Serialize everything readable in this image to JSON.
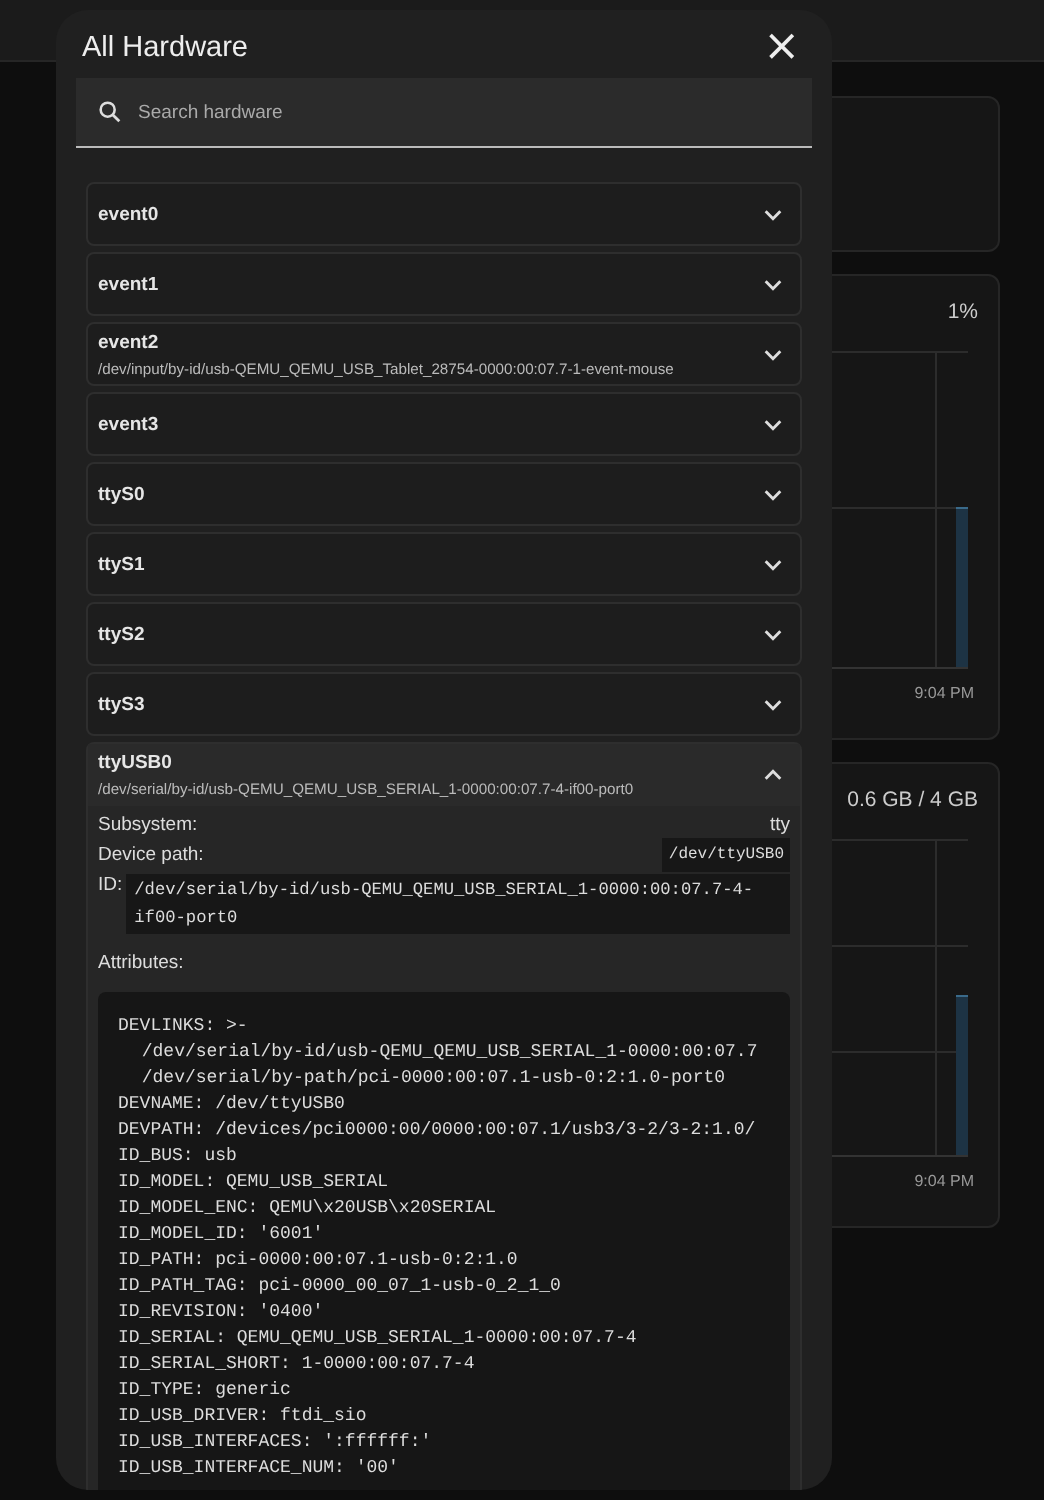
{
  "background": {
    "cards": [
      {
        "kind": "empty"
      },
      {
        "kind": "chart",
        "value": "1%",
        "time_label": "9:04 PM"
      },
      {
        "kind": "chart",
        "value": "0.6 GB / 4 GB",
        "time_label": "9:04 PM"
      }
    ]
  },
  "dialog": {
    "title": "All Hardware",
    "close": "×",
    "search": {
      "placeholder": "Search hardware"
    },
    "items": [
      {
        "name": "event0",
        "expanded": false
      },
      {
        "name": "event1",
        "expanded": false
      },
      {
        "name": "event2",
        "path": "/dev/input/by-id/usb-QEMU_QEMU_USB_Tablet_28754-0000:00:07.7-1-event-mouse",
        "expanded": false
      },
      {
        "name": "event3",
        "expanded": false
      },
      {
        "name": "ttyS0",
        "expanded": false
      },
      {
        "name": "ttyS1",
        "expanded": false
      },
      {
        "name": "ttyS2",
        "expanded": false
      },
      {
        "name": "ttyS3",
        "expanded": false
      },
      {
        "name": "ttyUSB0",
        "path": "/dev/serial/by-id/usb-QEMU_QEMU_USB_SERIAL_1-0000:00:07.7-4-if00-port0",
        "expanded": true,
        "details": {
          "subsystem_label": "Subsystem:",
          "subsystem": "tty",
          "device_path_label": "Device path:",
          "device_path": "/dev/ttyUSB0",
          "id_label": "ID:",
          "id": "/dev/serial/by-id/usb-QEMU_QEMU_USB_SERIAL_1-0000:00:07.7-4-if00-port0",
          "attributes_label": "Attributes:",
          "attributes": [
            {
              "kind": "key",
              "text": "DEVLINKS: >-"
            },
            {
              "kind": "continuation",
              "text": "/dev/serial/by-id/usb-QEMU_QEMU_USB_SERIAL_1-0000:00:07.7"
            },
            {
              "kind": "continuation",
              "text": "/dev/serial/by-path/pci-0000:00:07.1-usb-0:2:1.0-port0"
            },
            {
              "kind": "key",
              "text": "DEVNAME: /dev/ttyUSB0"
            },
            {
              "kind": "key",
              "text": "DEVPATH: /devices/pci0000:00/0000:00:07.1/usb3/3-2/3-2:1.0/"
            },
            {
              "kind": "key",
              "text": "ID_BUS: usb"
            },
            {
              "kind": "key",
              "text": "ID_MODEL: QEMU_USB_SERIAL"
            },
            {
              "kind": "key",
              "text": "ID_MODEL_ENC: QEMU\\x20USB\\x20SERIAL"
            },
            {
              "kind": "key",
              "text": "ID_MODEL_ID: '6001'"
            },
            {
              "kind": "key",
              "text": "ID_PATH: pci-0000:00:07.1-usb-0:2:1.0"
            },
            {
              "kind": "key",
              "text": "ID_PATH_TAG: pci-0000_00_07_1-usb-0_2_1_0"
            },
            {
              "kind": "key",
              "text": "ID_REVISION: '0400'"
            },
            {
              "kind": "key",
              "text": "ID_SERIAL: QEMU_QEMU_USB_SERIAL_1-0000:00:07.7-4"
            },
            {
              "kind": "key",
              "text": "ID_SERIAL_SHORT: 1-0000:00:07.7-4"
            },
            {
              "kind": "key",
              "text": "ID_TYPE: generic"
            },
            {
              "kind": "key",
              "text": "ID_USB_DRIVER: ftdi_sio"
            },
            {
              "kind": "key",
              "text": "ID_USB_INTERFACES: ':ffffff:'"
            },
            {
              "kind": "key",
              "text": "ID_USB_INTERFACE_NUM: '00'"
            }
          ]
        }
      }
    ]
  }
}
